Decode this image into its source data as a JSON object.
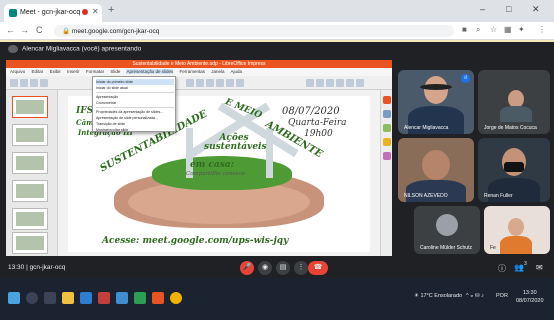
{
  "browser": {
    "tab_title": "Meet - gcn-jkar-ocq",
    "new_tab": "+",
    "minimize": "–",
    "maximize": "□",
    "close": "✕",
    "url": "meet.google.com/gcn-jkar-ocq",
    "nav_back": "←",
    "nav_forward": "→",
    "nav_reload": "C"
  },
  "meet": {
    "presenting_banner": "Alencar Migliavacca (você) apresentando",
    "meeting_code": "13:30 | gcn-jkar-ocq",
    "badge_count": "3",
    "colors": {
      "end_call": "#ea4335",
      "accent": "#1a73e8"
    }
  },
  "impress": {
    "title_bar": "Sustentabilidade e Meio Ambiente.odp - LibreOffice Impress",
    "menu": [
      "Arquivo",
      "Editar",
      "Exibir",
      "Inserir",
      "Formatar",
      "Slide",
      "Apresentação de slides",
      "Ferramentas",
      "Janela",
      "Ajuda"
    ],
    "dropdown_items": [
      "Iniciar do primeiro slide",
      "Iniciar do slide atual",
      "Apresentação",
      "Cronometrar",
      "Propriedades da apresentação de slides...",
      "Apresentação de slide personalizada...",
      "Transição de slide",
      "Mostrar/ocultar slide"
    ]
  },
  "slide": {
    "ifs": "IFS",
    "campus": "Câmpus",
    "integracao": "Integração III",
    "arc_left": "SUSTENTABILIDADE",
    "arc_mid": "E MEIO",
    "arc_right": "AMBIENTE",
    "date": "08/07/2020",
    "weekday": "Quarta-Feira",
    "time": "19h00",
    "acoes": "Ações sustentáveis",
    "em_casa": "em casa:",
    "compartilhe": "Compartilhe conosco",
    "acesse": "Acesse: meet.google.com/ups-wis-jqy"
  },
  "participants": [
    {
      "name": "Alencar Migliavacca"
    },
    {
      "name": "Jorge de Matos Cocuca"
    },
    {
      "name": "NILSON AZEVEDO"
    },
    {
      "name": "Renan Fuller"
    },
    {
      "name": "Caroline Mülder Schutz"
    },
    {
      "name": "Fe"
    }
  ],
  "taskbar": {
    "weather": "17°C Ensolarado",
    "time": "13:30",
    "date": "08/07/2020",
    "lang": "POR"
  }
}
